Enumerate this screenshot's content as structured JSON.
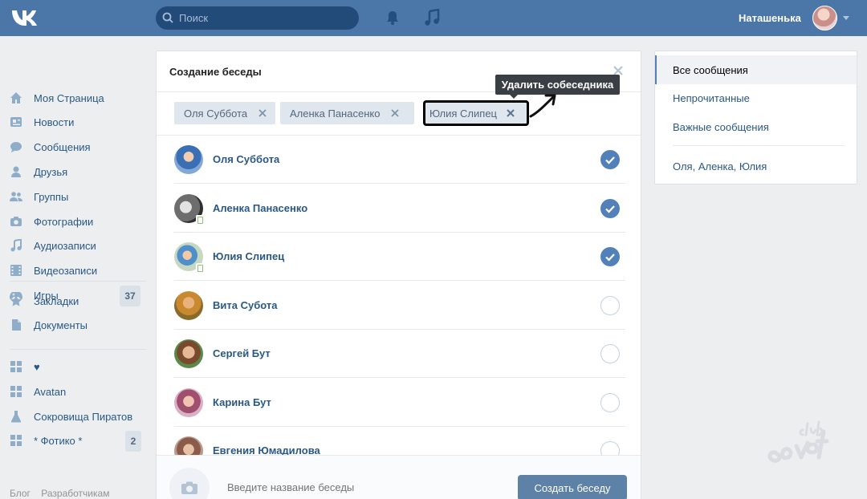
{
  "header": {
    "logo_icon": "vk-logo-icon",
    "search_placeholder": "Поиск",
    "user_name": "Наташенька"
  },
  "nav": {
    "items": [
      {
        "label": "Моя Страница",
        "icon": "home-icon"
      },
      {
        "label": "Новости",
        "icon": "news-icon"
      },
      {
        "label": "Сообщения",
        "icon": "chat-icon"
      },
      {
        "label": "Друзья",
        "icon": "person-icon"
      },
      {
        "label": "Группы",
        "icon": "group-icon"
      },
      {
        "label": "Фотографии",
        "icon": "camera-icon"
      },
      {
        "label": "Аудиозаписи",
        "icon": "music-icon"
      },
      {
        "label": "Видеозаписи",
        "icon": "video-icon"
      },
      {
        "label": "Игры",
        "icon": "gamepad-icon",
        "badge": "37"
      },
      {
        "label": "Закладки",
        "icon": "star-icon"
      },
      {
        "label": "Документы",
        "icon": "document-icon"
      },
      {
        "label": "♥",
        "icon": "app-grid-icon"
      },
      {
        "label": "Avatan",
        "icon": "app-grid-icon"
      },
      {
        "label": "Сокровища Пиратов",
        "icon": "flask-icon"
      },
      {
        "label": "* Фотико *",
        "icon": "app-grid-icon",
        "badge": "2"
      }
    ],
    "footer": [
      "Блог",
      "Разработчикам"
    ]
  },
  "dialog": {
    "title": "Создание беседы",
    "chips": [
      "Оля Суббота",
      "Аленка Панасенко",
      "Юлия Слипец"
    ],
    "tooltip": "Удалить собеседника",
    "friends": [
      {
        "name": "Оля Суббота",
        "selected": true
      },
      {
        "name": "Аленка Панасенко",
        "selected": true
      },
      {
        "name": "Юлия Слипец",
        "selected": true
      },
      {
        "name": "Вита Субота",
        "selected": false
      },
      {
        "name": "Сергей Бут",
        "selected": false
      },
      {
        "name": "Карина Бут",
        "selected": false
      },
      {
        "name": "Евгения Юмадилова",
        "selected": false
      }
    ],
    "name_placeholder": "Введите название беседы",
    "create_label": "Создать беседу"
  },
  "right_panel": {
    "items": [
      "Все сообщения",
      "Непрочитанные",
      "Важные сообщения"
    ],
    "conversation": "Оля, Аленка, Юлия"
  },
  "colors": {
    "header_bg": "#4a76a8",
    "link": "#2a5885",
    "accent": "#5181b8",
    "button": "#5e81a8"
  }
}
